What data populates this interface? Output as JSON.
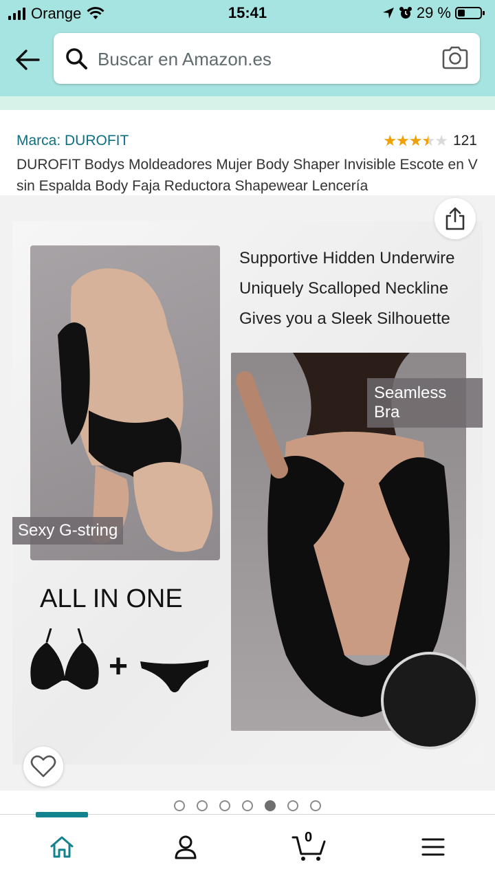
{
  "status_bar": {
    "carrier": "Orange",
    "time": "15:41",
    "battery": "29 %"
  },
  "search": {
    "placeholder": "Buscar en Amazon.es"
  },
  "product": {
    "brand": "Marca: DUROFIT",
    "rating": 3.5,
    "rating_max": 5,
    "rating_count": "121",
    "title": "DUROFIT Bodys Moldeadores Mujer Body Shaper Invisible Escote en V sin Espalda Body Faja Reductora Shapewear Lencería"
  },
  "image": {
    "features": [
      "Supportive Hidden Underwire",
      "Uniquely Scalloped Neckline",
      "Gives you a Sleek Silhouette"
    ],
    "label_left": "Sexy G-string",
    "label_right": "Seamless Bra",
    "all_in_one": "ALL IN ONE",
    "plus": "+"
  },
  "carousel": {
    "total": 7,
    "active_index": 4
  },
  "bottom_nav": {
    "cart_count": "0",
    "active": "home"
  },
  "colors": {
    "header_bg": "#a6e4e1",
    "brand_link": "#0f6f82",
    "star": "#f0a100",
    "nav_accent": "#12838e"
  },
  "icons": [
    "back-arrow-icon",
    "search-icon",
    "camera-icon",
    "share-icon",
    "heart-icon",
    "home-icon",
    "account-icon",
    "cart-icon",
    "menu-icon"
  ]
}
